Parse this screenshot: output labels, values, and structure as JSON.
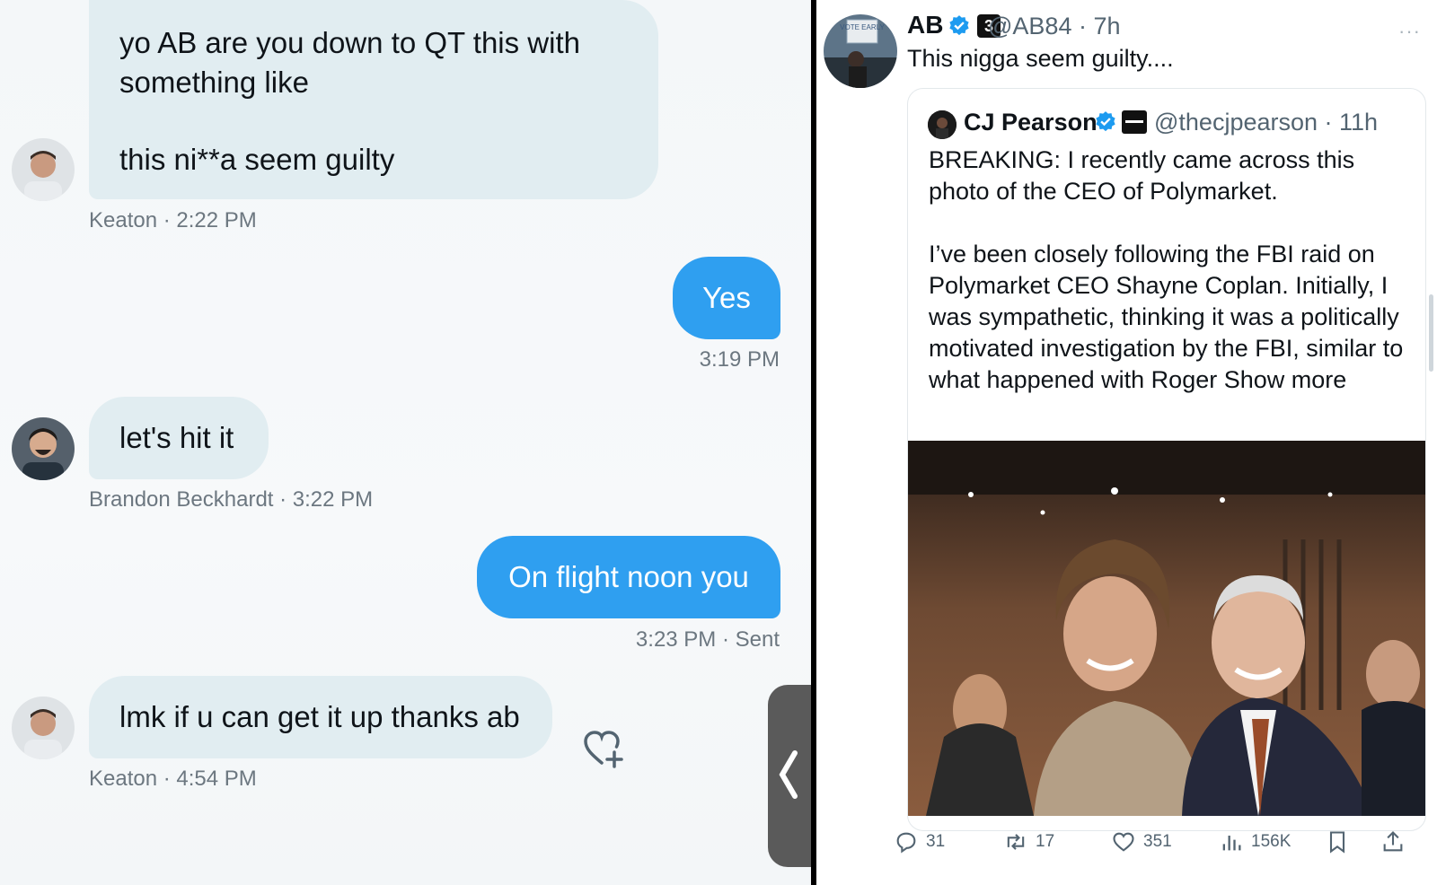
{
  "dm": {
    "messages": [
      {
        "sender": "Keaton",
        "text_line1": "yo AB are you down to QT this with",
        "text_line2": "something like",
        "text_line3": "this ni**a seem guilty",
        "time": "Keaton · 2:22 PM"
      },
      {
        "text": "Yes",
        "time": "3:19 PM"
      },
      {
        "sender": "Brandon Beckhardt",
        "text": "let's hit it",
        "time": "Brandon Beckhardt · 3:22 PM"
      },
      {
        "text": "On flight noon you",
        "time": "3:23 PM · Sent"
      },
      {
        "sender": "Keaton",
        "text": "lmk if u can get it up thanks ab",
        "time": "Keaton · 4:54 PM"
      }
    ]
  },
  "tweet": {
    "author_name": "AB",
    "author_handle": "@AB84 · 7h",
    "badge_letter": "3",
    "text": "This nigga seem guilty....",
    "more": "···",
    "avatar_sign_text": "VOTE EARLY",
    "quote": {
      "name": "CJ Pearson",
      "handle": "@thecjpearson · 11h",
      "para1": "BREAKING: I recently came across this photo of the CEO of Polymarket.",
      "para2": "I’ve been closely following the FBI raid on Polymarket CEO Shayne Coplan. Initially, I was sympathetic, thinking it was a politically motivated investigation by the FBI, similar to what happened with Roger",
      "show_more": "Show more"
    },
    "actions": {
      "replies": "31",
      "reposts": "17",
      "likes": "351",
      "views": "156K"
    }
  },
  "colors": {
    "bubble_out": "#2f9ff0",
    "bubble_in": "#e1edf1",
    "verified": "#1d9bf0"
  }
}
